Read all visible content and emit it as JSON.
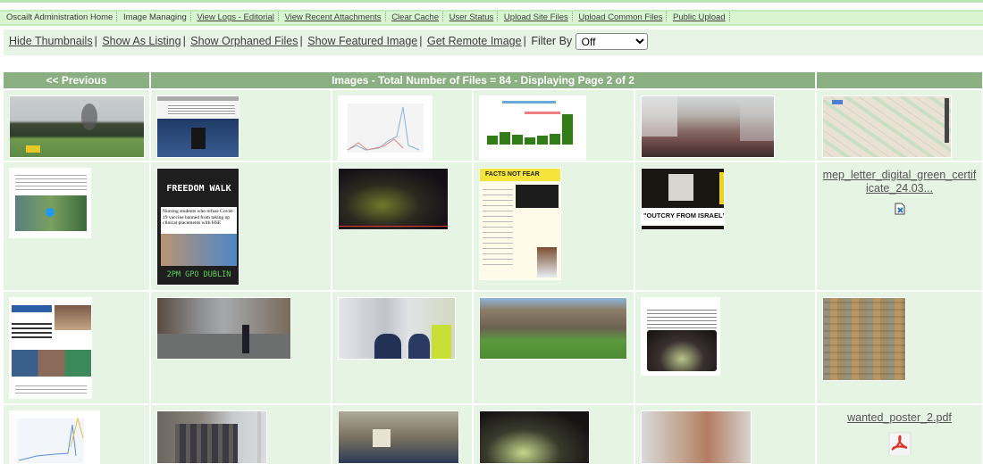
{
  "topnav": {
    "items": [
      {
        "label": "Oscailt Administration Home",
        "link": false
      },
      {
        "label": "Image Managing",
        "link": false
      },
      {
        "label": "View Logs - Editorial",
        "link": true
      },
      {
        "label": "View Recent Attachments",
        "link": true
      },
      {
        "label": "Clear Cache",
        "link": true
      },
      {
        "label": "User Status",
        "link": true
      },
      {
        "label": "Upload Site Files",
        "link": true
      },
      {
        "label": "Upload Common Files",
        "link": true
      },
      {
        "label": "Public Upload",
        "link": true
      }
    ]
  },
  "toolbar": {
    "links": [
      "Hide Thumbnails",
      "Show As Listing",
      "Show Orphaned Files",
      "Show Featured Image",
      "Get Remote Image"
    ],
    "filter_label": "Filter By",
    "filter_value": "Off"
  },
  "grid": {
    "prev_label": "<< Previous",
    "title": "Images - Total Number of Files = 84  - Displaying Page 2 of 2",
    "next_label": "",
    "rows": [
      [
        {
          "type": "image",
          "desc": "Park with trees and ambulances"
        },
        {
          "type": "image",
          "desc": "Dail chamber speaker with text"
        },
        {
          "type": "image",
          "desc": "COVID-19 data Ireland chart"
        },
        {
          "type": "image",
          "desc": "Deaths in 60 Irish nursing homes bar chart"
        },
        {
          "type": "image",
          "desc": "Protest crowd on street"
        },
        {
          "type": "image",
          "desc": "Street map"
        }
      ],
      [
        {
          "type": "image",
          "desc": "Tweet with video"
        },
        {
          "type": "image",
          "desc": "Freedom Walk poster",
          "texts": [
            "FREEDOM WALK",
            "Nursing students who refuse Covid-19 vaccine banned from taking up clinical placements with HSE",
            "2PM GPO DUBLIN"
          ]
        },
        {
          "type": "image",
          "desc": "Night police scuffle"
        },
        {
          "type": "image",
          "desc": "Facts Not Fear leaflet",
          "texts": [
            "FACTS NOT FEAR"
          ]
        },
        {
          "type": "image",
          "desc": "Outcry from Israel video still",
          "texts": [
            "\"OUTCRY FROM ISRAEL\""
          ]
        },
        {
          "type": "file",
          "name": "mep_letter_digital_green_certificate_24.03...",
          "icon": "document-edit-icon"
        }
      ],
      [
        {
          "type": "image",
          "desc": "News article screenshot"
        },
        {
          "type": "image",
          "desc": "Street with police"
        },
        {
          "type": "image",
          "desc": "Gardai at van"
        },
        {
          "type": "image",
          "desc": "Crowd in park"
        },
        {
          "type": "image",
          "desc": "Tweet with night crowd photo"
        },
        {
          "type": "image",
          "desc": "Collage of notes"
        }
      ],
      [
        {
          "type": "image",
          "desc": "COVID-19 line chart"
        },
        {
          "type": "image",
          "desc": "GPO building"
        },
        {
          "type": "image",
          "desc": "Protest crowd with placard"
        },
        {
          "type": "image",
          "desc": "Night crowd at bandstand"
        },
        {
          "type": "image",
          "desc": "City street"
        },
        {
          "type": "file",
          "name": "wanted_poster_2.pdf",
          "icon": "pdf-icon"
        }
      ]
    ]
  }
}
